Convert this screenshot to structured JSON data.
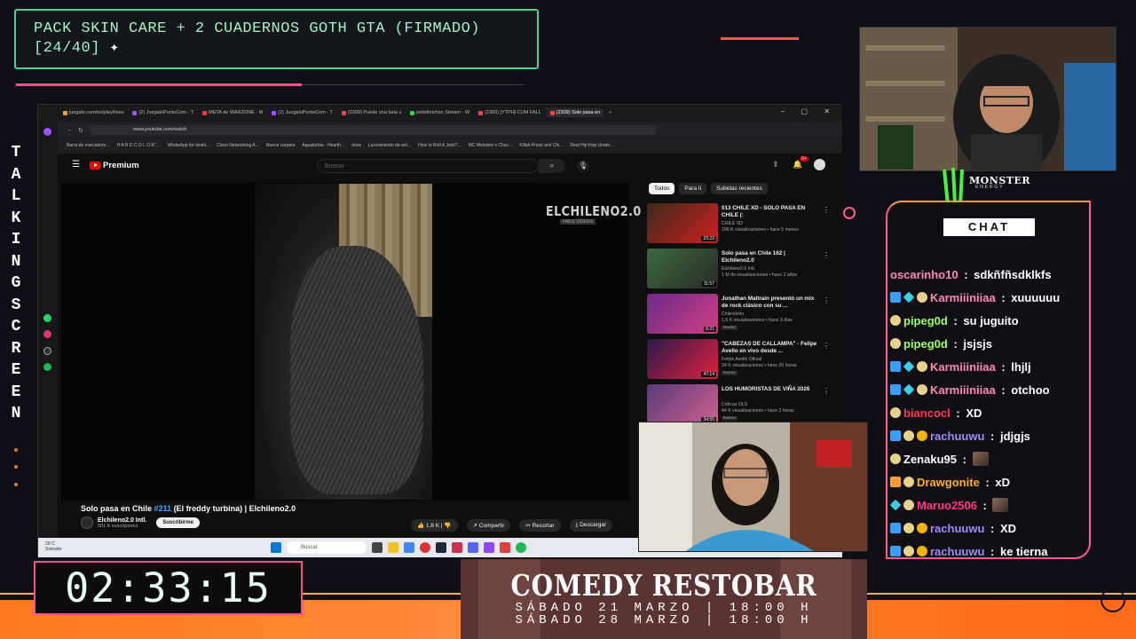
{
  "goal": {
    "line1": "PACK SKIN CARE + 2 CUADERNOS GOTH GTA (FIRMADO)",
    "line2": "[24/40]",
    "icon": "sparkle-icon"
  },
  "side_text": "TALKINGSCREEN",
  "browser": {
    "tabs": [
      "juegalo.com/es/play/lines",
      "(2) JuegaloPuntoCom - T",
      "META de WARZONE - M",
      "(2) JuegaloPuntoCom - T",
      "(2309) Puede una bala s",
      "jeidefinichon Stream - W",
      "(2309) [YTPH] CUM FALL",
      "(2309) Solo pasa en"
    ],
    "address": "www.youtube.com/watch",
    "bookmarks": [
      "Barra de marcadore...",
      "H A R D C O L O R '...",
      "WhatsApp for deskt...",
      "Cisco Networking A...",
      "Nueva carpeta",
      "Aguaturbia - Hearth...",
      "drew",
      "Lanzamiento de arti...",
      "How to Roll A Joint?...",
      "MC Melodee x Chuc...",
      "Killah Priest and Chi...",
      "Real Hip Hop Under..."
    ]
  },
  "youtube": {
    "logo": "Premium",
    "search_placeholder": "Buscar",
    "notif_count": "9+",
    "watermark": "ELCHILENO2.0",
    "watermark_sub": "FAILS VIDEOS",
    "title_prefix": "Solo pasa en Chile ",
    "title_tag": "#211",
    "title_suffix": " (El freddy turbina) | Elchileno2.0",
    "channel": "Elchileno2.0 Intl.",
    "subs": "501 K suscriptores",
    "subscribe": "Suscribirme",
    "likes": "1,6 K",
    "share": "Compartir",
    "clip": "Recortar",
    "download": "Descargar",
    "chips": [
      "Todos",
      "Para ti",
      "Subidas recientes"
    ],
    "recs": [
      {
        "title": "013 CHILE XD - SOLO PASA EN CHILE (:",
        "channel": "CHILE XD",
        "meta": "196 K visualizaciones • hace 5 meses",
        "dur": "23:22",
        "badge": "",
        "c1": "#3a2a1a",
        "c2": "#d02020"
      },
      {
        "title": "Solo pasa en Chile 162 | Elchileno2.0",
        "channel": "Elchileno2.0 Intl.",
        "meta": "1 M de visualizaciones • hace 2 años",
        "dur": "11:57",
        "badge": "",
        "c1": "#3a6a3a",
        "c2": "#2a2a2a"
      },
      {
        "title": "Jonathan Maltrain presentó un mix de rock clásico con su ...",
        "channel": "Chilevisión",
        "meta": "1,6 K visualizaciones • hace 3 días",
        "dur": "6:21",
        "badge": "Nuevo",
        "c1": "#6a2a8a",
        "c2": "#d04080"
      },
      {
        "title": "\"CABEZAS DE CALLAMPA\" - Felipe Avello en vivo desde ...",
        "channel": "Felipe Avello Oficial",
        "meta": "34 K visualizaciones • hace 20 horas",
        "dur": "47:14",
        "badge": "Nuevo",
        "c1": "#2a1a4a",
        "c2": "#e02040"
      },
      {
        "title": "LOS HUMORISTAS DE VIÑA 2026",
        "channel": "Criticas OLS",
        "meta": "44 K visualizaciones • hace 3 horas",
        "dur": "34:55",
        "badge": "Nuevo",
        "c1": "#5a3a7a",
        "c2": "#d06090"
      }
    ],
    "taskbar_search": "Buscar",
    "weather_temp": "26°C",
    "weather_desc": "Soleado"
  },
  "monster": {
    "name": "MONSTER",
    "sub": "ENERGY"
  },
  "chat": {
    "title": "CHAT",
    "messages": [
      {
        "user": "oscarinho10",
        "text": "sdkñfñsdklkfs",
        "color": "#ff8ab0",
        "badges": [],
        "emote": false
      },
      {
        "user": "Karmiiiniiaa",
        "text": "xuuuuuu",
        "color": "#ff8ab0",
        "badges": [
          "b-blue",
          "b-cyan",
          "b-emo"
        ],
        "emote": false
      },
      {
        "user": "pipeg0d",
        "text": "su juguito",
        "color": "#9cff5a",
        "badges": [
          "b-emo"
        ],
        "emote": false
      },
      {
        "user": "pipeg0d",
        "text": "jsjsjs",
        "color": "#9cff5a",
        "badges": [
          "b-emo"
        ],
        "emote": false
      },
      {
        "user": "Karmiiiniiaa",
        "text": "lhjlj",
        "color": "#ff8ab0",
        "badges": [
          "b-blue",
          "b-cyan",
          "b-emo"
        ],
        "emote": false
      },
      {
        "user": "Karmiiiniiaa",
        "text": "otchoo",
        "color": "#ff8ab0",
        "badges": [
          "b-blue",
          "b-cyan",
          "b-emo"
        ],
        "emote": false
      },
      {
        "user": "biancocl",
        "text": "XD",
        "color": "#ff3a5a",
        "badges": [
          "b-emo"
        ],
        "emote": false
      },
      {
        "user": "rachuuwu",
        "text": "jdjgjs",
        "color": "#a08aff",
        "badges": [
          "b-blue",
          "b-emo",
          "b-gold"
        ],
        "emote": false
      },
      {
        "user": "Zenaku95",
        "text": "",
        "color": "#ffffff",
        "badges": [
          "b-emo"
        ],
        "emote": true
      },
      {
        "user": "Drawgonite",
        "text": "xD",
        "color": "#ffb020",
        "badges": [
          "b-orange",
          "b-emo"
        ],
        "emote": false
      },
      {
        "user": "Maruo2506",
        "text": "",
        "color": "#ff3a7a",
        "badges": [
          "b-cyan",
          "b-emo"
        ],
        "emote": true
      },
      {
        "user": "rachuuwu",
        "text": "XD",
        "color": "#a08aff",
        "badges": [
          "b-blue",
          "b-emo",
          "b-gold"
        ],
        "emote": false
      },
      {
        "user": "rachuuwu",
        "text": "ke tierna",
        "color": "#a08aff",
        "badges": [
          "b-blue",
          "b-emo",
          "b-gold"
        ],
        "emote": false
      }
    ]
  },
  "timer": "02:33:15",
  "comedy": {
    "title": "COMEDY RESTOBAR",
    "line1": "SÁBADO 21 MARZO | 18:00 H",
    "line2": "SÁBADO 28 MARZO | 18:00 H"
  },
  "colors": {
    "accent_pink": "#ff4f8a",
    "accent_green": "#4ad38e",
    "band_orange": "#ff7a1e",
    "yt_red": "#ff0000"
  }
}
